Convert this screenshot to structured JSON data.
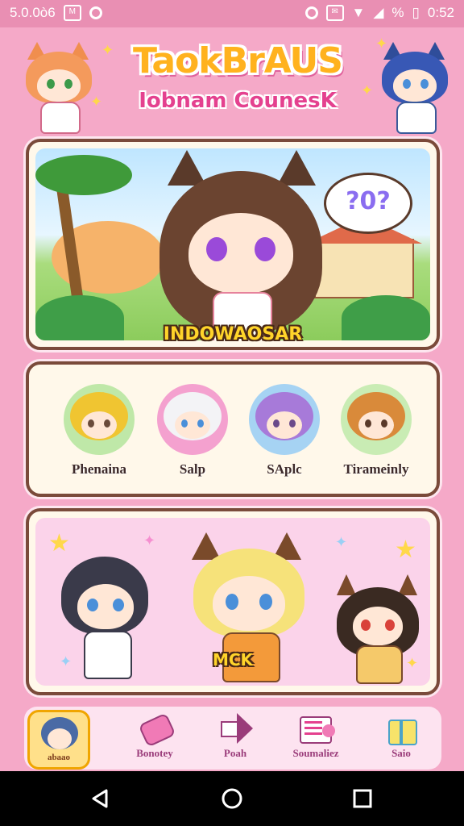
{
  "status_bar": {
    "left_text": "5.0.0ò6",
    "right_text": "0:52",
    "percent": "%"
  },
  "header": {
    "title_line1": "TaokBrAUS",
    "title_line2": "Iobnam CounesK"
  },
  "banner": {
    "label": "INDOWAOSAR",
    "bubble_text": "?0?"
  },
  "roster": [
    {
      "name": "Phenaina",
      "hair": "#f0c531",
      "bg": "#bfe8a8",
      "icon": "blonde-cat-girl-icon"
    },
    {
      "name": "Salp",
      "hair": "#f3f3f6",
      "bg": "#f4a1cf",
      "icon": "white-hair-cat-girl-icon"
    },
    {
      "name": "SAplc",
      "hair": "#a77ad9",
      "bg": "#a6d3f3",
      "icon": "purple-hair-cat-girl-icon"
    },
    {
      "name": "Tirameinly",
      "hair": "#d98a3a",
      "bg": "#c9ecb4",
      "icon": "orange-hair-cat-boy-icon"
    }
  ],
  "party": {
    "label": "MCK"
  },
  "nav": {
    "items": [
      {
        "label": "abaao",
        "icon": "profile-avatar-icon"
      },
      {
        "label": "Bonotey",
        "icon": "ticket-icon"
      },
      {
        "label": "Poah",
        "icon": "arrow-right-icon"
      },
      {
        "label": "Soumaliez",
        "icon": "list-book-icon"
      },
      {
        "label": "Saio",
        "icon": "gift-box-icon"
      }
    ]
  },
  "colors": {
    "background": "#f5a9c8",
    "panel_border": "#7a4a3a",
    "accent": "#e4418f",
    "gold": "#ffd42a"
  }
}
